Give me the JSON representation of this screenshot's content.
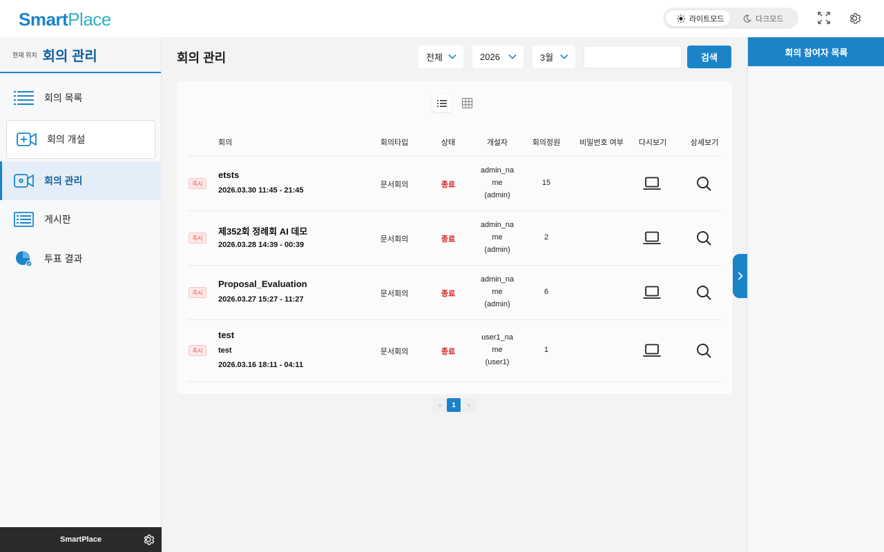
{
  "header": {
    "logo_part1": "Smart",
    "logo_part2": "Place",
    "mode_light": "라이트모드",
    "mode_dark": "다크모드"
  },
  "sidebar": {
    "location_label": "현재 위치",
    "location_value": "회의 관리",
    "items": [
      {
        "label": "회의 목록"
      },
      {
        "label": "회의 개설"
      },
      {
        "label": "회의 관리"
      },
      {
        "label": "게시판"
      },
      {
        "label": "투표 결과"
      }
    ],
    "footer": "SmartPlace"
  },
  "main": {
    "title": "회의 관리",
    "filters": {
      "type_value": "전체",
      "year_value": "2026",
      "month_value": "3월",
      "search_value": "",
      "search_button": "검색"
    },
    "table": {
      "headers": [
        "회의",
        "회의타입",
        "상태",
        "개설자",
        "회의정원",
        "비밀번호 여부",
        "다시보기",
        "상세보기"
      ],
      "rows": [
        {
          "badge": "즉시",
          "title": "etsts",
          "subtitle": "",
          "time": "2026.03.30 11:45 - 21:45",
          "type": "문서회의",
          "status": "종료",
          "creator_l1": "admin_na",
          "creator_l2": "me",
          "creator_l3": "(admin)",
          "capacity": "15",
          "password": ""
        },
        {
          "badge": "즉시",
          "title": "제352회 정례회 AI 데모",
          "subtitle": "",
          "time": "2026.03.28 14:39 - 00:39",
          "type": "문서회의",
          "status": "종료",
          "creator_l1": "admin_na",
          "creator_l2": "me",
          "creator_l3": "(admin)",
          "capacity": "2",
          "password": ""
        },
        {
          "badge": "즉시",
          "title": "Proposal_Evaluation",
          "subtitle": "",
          "time": "2026.03.27 15:27 - 11:27",
          "type": "문서회의",
          "status": "종료",
          "creator_l1": "admin_na",
          "creator_l2": "me",
          "creator_l3": "(admin)",
          "capacity": "6",
          "password": ""
        },
        {
          "badge": "즉시",
          "title": "test",
          "subtitle": "test",
          "time": "2026.03.16 18:11 - 04:11",
          "type": "문서회의",
          "status": "종료",
          "creator_l1": "user1_na",
          "creator_l2": "me",
          "creator_l3": "(user1)",
          "capacity": "1",
          "password": ""
        }
      ]
    },
    "pagination": {
      "prev": "«",
      "current": "1",
      "next": "»"
    }
  },
  "right_panel": {
    "title": "회의 참여자 목록"
  },
  "colors": {
    "accent": "#1b84c9",
    "status_ended": "#d91f1f",
    "badge_bg": "#fde7e7"
  },
  "icons": [
    "sun-icon",
    "moon-icon",
    "fullscreen-icon",
    "gear-icon",
    "list-icon",
    "video-add-icon",
    "video-settings-icon",
    "board-icon",
    "pie-chart-icon",
    "list-view-icon",
    "grid-view-icon",
    "laptop-icon",
    "search-icon",
    "chevron-right-icon",
    "chevron-down-icon"
  ]
}
